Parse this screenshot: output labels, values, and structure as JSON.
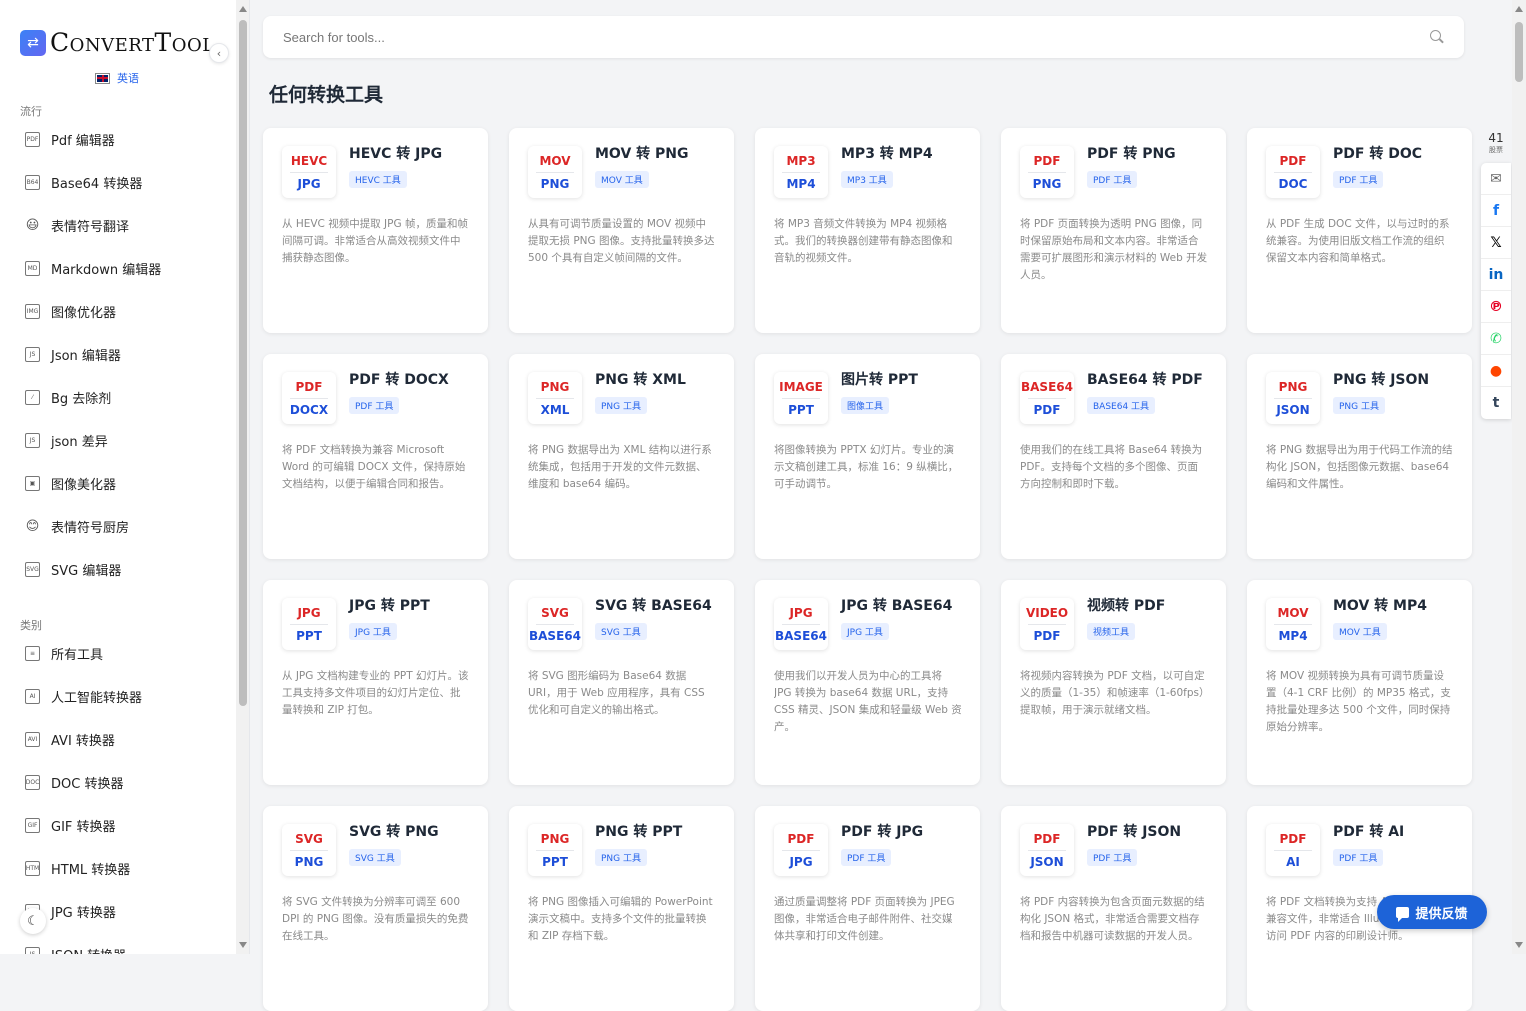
{
  "app": {
    "logo_text": "ConvertTool",
    "language": "英语"
  },
  "sidebar": {
    "popular_label": "流行",
    "popular": [
      {
        "label": "Pdf 编辑器",
        "icon": "PDF",
        "emoji": false,
        "name": "pdf-editor"
      },
      {
        "label": "Base64 转换器",
        "icon": "B64",
        "emoji": false,
        "name": "base64-converter"
      },
      {
        "label": "表情符号翻译",
        "icon": "😃",
        "emoji": true,
        "name": "emoji-translator"
      },
      {
        "label": "Markdown 编辑器",
        "icon": "MD",
        "emoji": false,
        "name": "markdown-editor"
      },
      {
        "label": "图像优化器",
        "icon": "IMG",
        "emoji": false,
        "name": "image-optimizer"
      },
      {
        "label": "Json 编辑器",
        "icon": "JS",
        "emoji": false,
        "name": "json-editor"
      },
      {
        "label": "Bg 去除剂",
        "icon": "⁄",
        "emoji": false,
        "name": "bg-remover"
      },
      {
        "label": "json 差异",
        "icon": "JS",
        "emoji": false,
        "name": "json-diff"
      },
      {
        "label": "图像美化器",
        "icon": "▣",
        "emoji": false,
        "name": "image-beautifier"
      },
      {
        "label": "表情符号厨房",
        "icon": "😊",
        "emoji": true,
        "name": "emoji-kitchen"
      },
      {
        "label": "SVG 编辑器",
        "icon": "SVG",
        "emoji": false,
        "name": "svg-editor"
      }
    ],
    "categories_label": "类别",
    "categories": [
      {
        "label": "所有工具",
        "icon": "≡",
        "emoji": false,
        "name": "all-tools"
      },
      {
        "label": "人工智能转换器",
        "icon": "AI",
        "emoji": false,
        "name": "ai-converter"
      },
      {
        "label": "AVI 转换器",
        "icon": "AVI",
        "emoji": false,
        "name": "avi-converter"
      },
      {
        "label": "DOC 转换器",
        "icon": "DOC",
        "emoji": false,
        "name": "doc-converter"
      },
      {
        "label": "GIF 转换器",
        "icon": "GIF",
        "emoji": false,
        "name": "gif-converter"
      },
      {
        "label": "HTML 转换器",
        "icon": "HTM",
        "emoji": false,
        "name": "html-converter"
      },
      {
        "label": "JPG 转换器",
        "icon": "JPG",
        "emoji": false,
        "name": "jpg-converter"
      },
      {
        "label": "JSON 转换器",
        "icon": "JS",
        "emoji": false,
        "name": "json-converter"
      }
    ]
  },
  "search": {
    "placeholder": "Search for tools..."
  },
  "main": {
    "title": "任何转换工具",
    "cards": [
      {
        "from": "HEVC",
        "to": "JPG",
        "title": "HEVC 转 JPG",
        "badge": "HEVC 工具",
        "desc": "从 HEVC 视频中提取 JPG 帧，质量和帧间隔可调。非常适合从高效视频文件中捕获静态图像。"
      },
      {
        "from": "MOV",
        "to": "PNG",
        "title": "MOV 转 PNG",
        "badge": "MOV 工具",
        "desc": "从具有可调节质量设置的 MOV 视频中提取无损 PNG 图像。支持批量转换多达 500 个具有自定义帧间隔的文件。"
      },
      {
        "from": "MP3",
        "to": "MP4",
        "title": "MP3 转 MP4",
        "badge": "MP3 工具",
        "desc": "将 MP3 音频文件转换为 MP4 视频格式。我们的转换器创建带有静态图像和音轨的视频文件。"
      },
      {
        "from": "PDF",
        "to": "PNG",
        "title": "PDF 转 PNG",
        "badge": "PDF 工具",
        "desc": "将 PDF 页面转换为透明 PNG 图像，同时保留原始布局和文本内容。非常适合需要可扩展图形和演示材料的 Web 开发人员。"
      },
      {
        "from": "PDF",
        "to": "DOC",
        "title": "PDF 转 DOC",
        "badge": "PDF 工具",
        "desc": "从 PDF 生成 DOC 文件，以与过时的系统兼容。为使用旧版文档工作流的组织保留文本内容和简单格式。"
      },
      {
        "from": "PDF",
        "to": "DOCX",
        "title": "PDF 转 DOCX",
        "badge": "PDF 工具",
        "desc": "将 PDF 文档转换为兼容 Microsoft Word 的可编辑 DOCX 文件，保持原始文档结构，以便于编辑合同和报告。"
      },
      {
        "from": "PNG",
        "to": "XML",
        "title": "PNG 转 XML",
        "badge": "PNG 工具",
        "desc": "将 PNG 数据导出为 XML 结构以进行系统集成，包括用于开发的文件元数据、维度和 base64 编码。"
      },
      {
        "from": "IMAGE",
        "to": "PPT",
        "title": "图片转 PPT",
        "badge": "图像工具",
        "desc": "将图像转换为 PPTX 幻灯片。专业的演示文稿创建工具，标准 16：9 纵横比，可手动调节。"
      },
      {
        "from": "BASE64",
        "to": "PDF",
        "title": "BASE64 转 PDF",
        "badge": "BASE64 工具",
        "desc": "使用我们的在线工具将 Base64 转换为 PDF。支持每个文档的多个图像、页面方向控制和即时下载。"
      },
      {
        "from": "PNG",
        "to": "JSON",
        "title": "PNG 转 JSON",
        "badge": "PNG 工具",
        "desc": "将 PNG 数据导出为用于代码工作流的结构化 JSON，包括图像元数据、base64 编码和文件属性。"
      },
      {
        "from": "JPG",
        "to": "PPT",
        "title": "JPG 转 PPT",
        "badge": "JPG 工具",
        "desc": "从 JPG 文档构建专业的 PPT 幻灯片。该工具支持多文件项目的幻灯片定位、批量转换和 ZIP 打包。"
      },
      {
        "from": "SVG",
        "to": "BASE64",
        "title": "SVG 转 BASE64",
        "badge": "SVG 工具",
        "desc": "将 SVG 图形编码为 Base64 数据 URI，用于 Web 应用程序，具有 CSS 优化和可自定义的输出格式。"
      },
      {
        "from": "JPG",
        "to": "BASE64",
        "title": "JPG 转 BASE64",
        "badge": "JPG 工具",
        "desc": "使用我们以开发人员为中心的工具将 JPG 转换为 base64 数据 URL，支持 CSS 精灵、JSON 集成和轻量级 Web 资产。"
      },
      {
        "from": "VIDEO",
        "to": "PDF",
        "title": "视频转 PDF",
        "badge": "视频工具",
        "desc": "将视频内容转换为 PDF 文档，以可自定义的质量（1-35）和帧速率（1-60fps）提取帧，用于演示就绪文档。"
      },
      {
        "from": "MOV",
        "to": "MP4",
        "title": "MOV 转 MP4",
        "badge": "MOV 工具",
        "desc": "将 MOV 视频转换为具有可调节质量设置（4-1 CRF 比例）的 MP35 格式，支持批量处理多达 500 个文件，同时保持原始分辨率。"
      },
      {
        "from": "SVG",
        "to": "PNG",
        "title": "SVG 转 PNG",
        "badge": "SVG 工具",
        "desc": "将 SVG 文件转换为分辨率可调至 600 DPI 的 PNG 图像。没有质量损失的免费在线工具。"
      },
      {
        "from": "PNG",
        "to": "PPT",
        "title": "PNG 转 PPT",
        "badge": "PNG 工具",
        "desc": "将 PNG 图像插入可编辑的 PowerPoint 演示文稿中。支持多个文件的批量转换和 ZIP 存档下载。"
      },
      {
        "from": "PDF",
        "to": "JPG",
        "title": "PDF 转 JPG",
        "badge": "PDF 工具",
        "desc": "通过质量调整将 PDF 页面转换为 JPEG 图像，非常适合电子邮件附件、社交媒体共享和打印文件创建。"
      },
      {
        "from": "PDF",
        "to": "JSON",
        "title": "PDF 转 JSON",
        "badge": "PDF 工具",
        "desc": "将 PDF 内容转换为包含页面元数据的结构化 JSON 格式，非常适合需要文档存档和报告中机器可读数据的开发人员。"
      },
      {
        "from": "PDF",
        "to": "AI",
        "title": "PDF 转 AI",
        "badge": "PDF 工具",
        "desc": "将 PDF 文档转换为支持 Adobe 的 AI 兼容文件，非常适合 Illustrator 中矢量访问 PDF 内容的印刷设计师。"
      }
    ]
  },
  "share": {
    "count": "41",
    "count_label": "股票",
    "buttons": [
      {
        "name": "email-share-button",
        "icon": "email-icon",
        "glyph": "✉",
        "color": "#666666"
      },
      {
        "name": "facebook-share-button",
        "icon": "facebook-icon",
        "glyph": "f",
        "color": "#1877f2"
      },
      {
        "name": "x-share-button",
        "icon": "x-icon",
        "glyph": "𝕏",
        "color": "#000000"
      },
      {
        "name": "linkedin-share-button",
        "icon": "linkedin-icon",
        "glyph": "in",
        "color": "#0a66c2"
      },
      {
        "name": "pinterest-share-button",
        "icon": "pinterest-icon",
        "glyph": "℗",
        "color": "#e60023"
      },
      {
        "name": "whatsapp-share-button",
        "icon": "whatsapp-icon",
        "glyph": "✆",
        "color": "#25d366"
      },
      {
        "name": "reddit-share-button",
        "icon": "reddit-icon",
        "glyph": "●",
        "color": "#ff4500"
      },
      {
        "name": "tumblr-share-button",
        "icon": "tumblr-icon",
        "glyph": "t",
        "color": "#35465c"
      }
    ]
  },
  "feedback": {
    "label": "提供反馈"
  }
}
